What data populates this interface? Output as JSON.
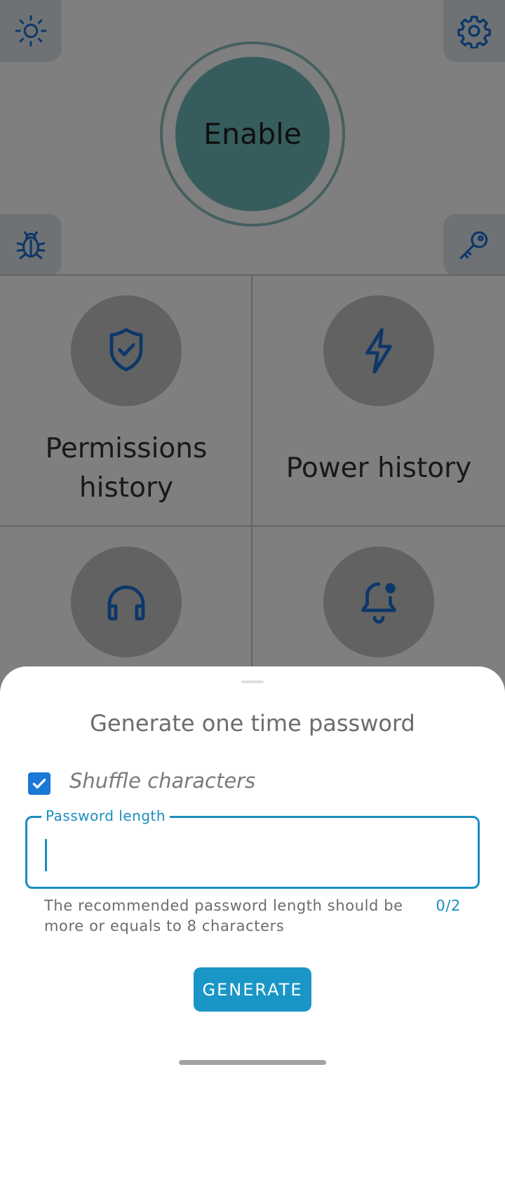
{
  "main": {
    "enable_label": "Enable",
    "tiles": [
      {
        "label": "Permissions history",
        "icon": "shield-check-icon"
      },
      {
        "label": "Power history",
        "icon": "lightning-icon"
      },
      {
        "label": "",
        "icon": "headphones-icon"
      },
      {
        "label": "",
        "icon": "bell-badge-icon"
      }
    ],
    "corner_icons": [
      "sun-icon",
      "gear-icon",
      "bug-icon",
      "key-icon"
    ]
  },
  "sheet": {
    "title": "Generate one time password",
    "shuffle_label": "Shuffle characters",
    "shuffle_checked": true,
    "field_label": "Password length",
    "field_value": "",
    "helper_text": "The recommended password length should be more or equals to 8 characters",
    "counter": "0/2",
    "generate_label": "GENERATE"
  },
  "colors": {
    "accent": "#1a96c6",
    "checkbox": "#1a78d6",
    "enable": "#6fb9bd",
    "icon": "#1a6fd1"
  }
}
